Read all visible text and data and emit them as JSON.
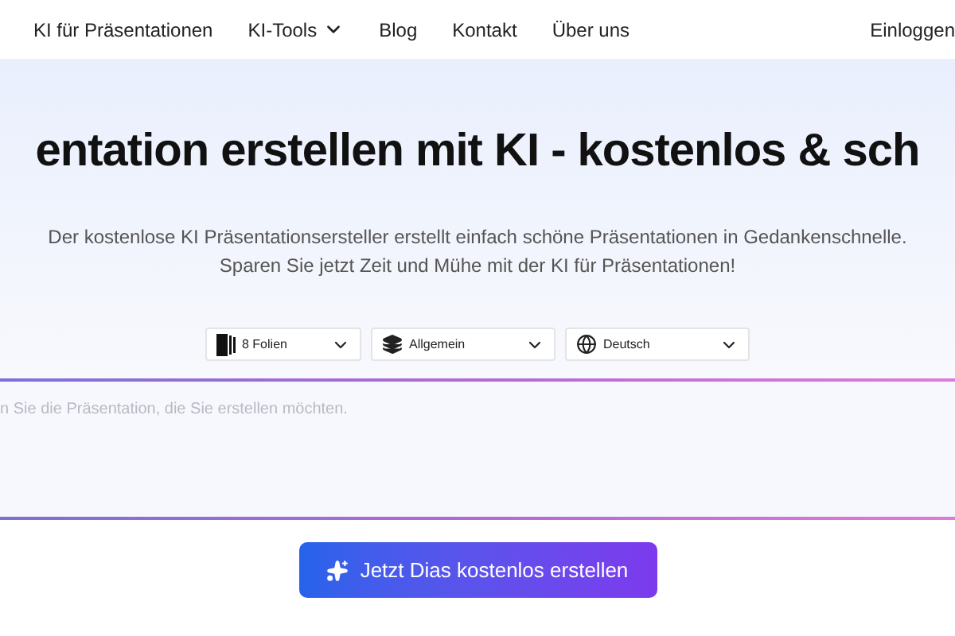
{
  "nav": {
    "items": [
      {
        "label": "KI für Präsentationen",
        "has_menu": false
      },
      {
        "label": "KI-Tools",
        "has_menu": true
      },
      {
        "label": "Blog",
        "has_menu": false
      },
      {
        "label": "Kontakt",
        "has_menu": false
      },
      {
        "label": "Über uns",
        "has_menu": false
      }
    ],
    "login": "Einloggen"
  },
  "hero": {
    "title": "entation erstellen mit KI - kostenlos & sch",
    "subtitle": "Der kostenlose KI Präsentationsersteller erstellt einfach schöne Präsentationen in Gedankenschnelle. Sparen Sie jetzt Zeit und Mühe mit der KI für Präsentationen!"
  },
  "selects": [
    {
      "kind": "slides",
      "value": "8 Folien"
    },
    {
      "kind": "style",
      "value": "Allgemein"
    },
    {
      "kind": "language",
      "value": "Deutsch"
    }
  ],
  "prompt": {
    "placeholder": "n Sie die Präsentation, die Sie erstellen möchten."
  },
  "button": "Jetzt Dias kostenlos erstellen"
}
